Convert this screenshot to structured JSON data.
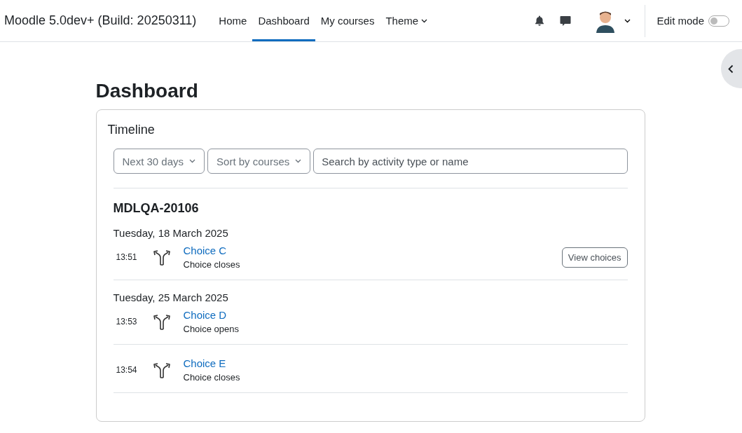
{
  "navbar": {
    "site_name": "Moodle 5.0dev+ (Build: 20250311)",
    "links": [
      {
        "label": "Home",
        "selected": false,
        "dropdown": false
      },
      {
        "label": "Dashboard",
        "selected": true,
        "dropdown": false
      },
      {
        "label": "My courses",
        "selected": false,
        "dropdown": false
      },
      {
        "label": "Theme",
        "selected": false,
        "dropdown": true
      }
    ],
    "edit_mode": {
      "label": "Edit mode",
      "on": false
    }
  },
  "page": {
    "title": "Dashboard"
  },
  "timeline": {
    "title": "Timeline",
    "filters": [
      {
        "label": "Next 30 days"
      },
      {
        "label": "Sort by courses"
      }
    ],
    "search": {
      "placeholder": "Search by activity type or name"
    },
    "course": "MDLQA-20106",
    "days": [
      {
        "date": "Tuesday, 18 March 2025",
        "events": [
          {
            "time": "13:51",
            "name": "Choice C",
            "status": "Choice closes",
            "action": "View choices"
          }
        ]
      },
      {
        "date": "Tuesday, 25 March 2025",
        "events": [
          {
            "time": "13:53",
            "name": "Choice D",
            "status": "Choice opens"
          },
          {
            "time": "13:54",
            "name": "Choice E",
            "status": "Choice closes"
          }
        ]
      }
    ]
  }
}
